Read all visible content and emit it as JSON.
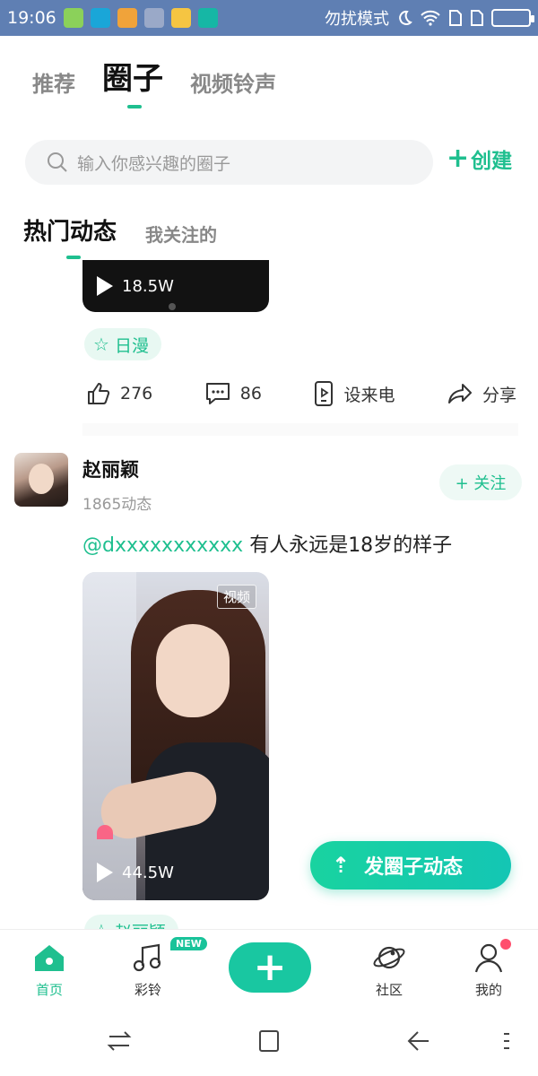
{
  "status_bar": {
    "time": "19:06",
    "dnd_text": "勿扰模式"
  },
  "top_tabs": [
    {
      "label": "推荐"
    },
    {
      "label": "圈子"
    },
    {
      "label": "视频铃声"
    }
  ],
  "search": {
    "placeholder": "输入你感兴趣的圈子"
  },
  "create_label": "创建",
  "sub_tabs": [
    {
      "label": "热门动态"
    },
    {
      "label": "我关注的"
    }
  ],
  "prev_post": {
    "play_count": "18.5W",
    "tag": "日漫",
    "likes": "276",
    "comments": "86",
    "set_ringtone": "设来电",
    "share": "分享"
  },
  "post": {
    "user_name": "赵丽颖",
    "user_count": "1865动态",
    "follow_label": "+ 关注",
    "mention": "@dxxxxxxxxxxx",
    "text": "有人永远是18岁的样子",
    "video_badge": "视频",
    "play_count": "44.5W",
    "tag": "赵丽颖"
  },
  "fab_label": "发圈子动态",
  "bottom_nav": {
    "home": "首页",
    "ringtone": "彩铃",
    "new_badge": "NEW",
    "community": "社区",
    "mine": "我的"
  },
  "colors": {
    "accent": "#1fbf8f",
    "status_bar": "#5f7fb3"
  }
}
